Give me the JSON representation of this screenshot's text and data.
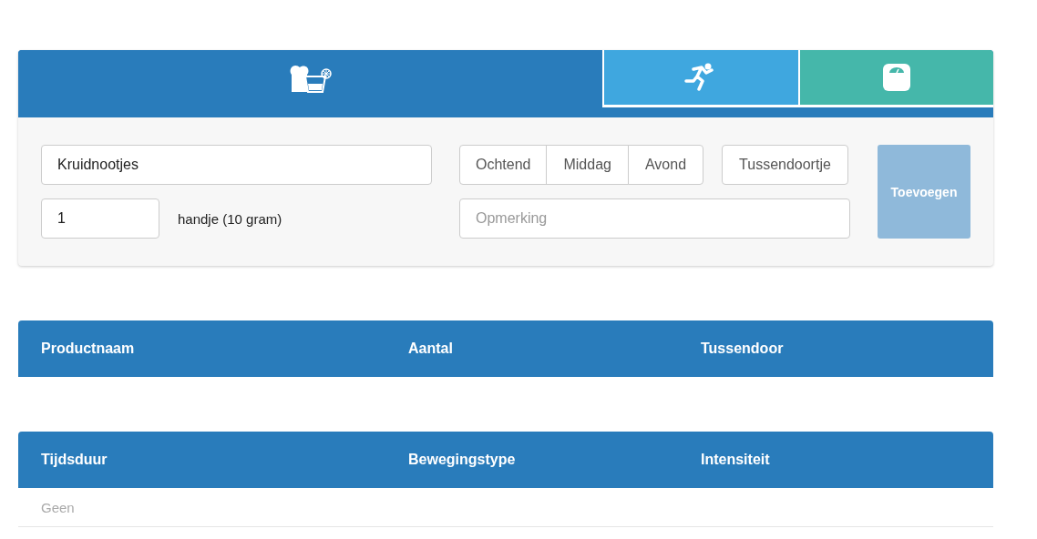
{
  "tabs": [
    {
      "kind": "food",
      "selected": true,
      "color": "#297cbb"
    },
    {
      "kind": "activity",
      "selected": false,
      "color": "#3fa7df"
    },
    {
      "kind": "weight",
      "selected": false,
      "color": "#45b7aa"
    }
  ],
  "form": {
    "product": {
      "value": "Kruidnootjes"
    },
    "amount": {
      "value": "1"
    },
    "unit": "handje (10 gram)",
    "moments": [
      {
        "label": "Ochtend",
        "selected": false
      },
      {
        "label": "Middag",
        "selected": false
      },
      {
        "label": "Avond",
        "selected": false
      }
    ],
    "snack": {
      "label": "Tussendoortje",
      "selected": false
    },
    "remark": {
      "placeholder": "Opmerking"
    },
    "add_button": {
      "label": "Toevoegen",
      "disabled": true
    }
  },
  "tables": [
    {
      "columns": [
        "Productnaam",
        "Aantal",
        "Tussendoor"
      ]
    },
    {
      "columns": [
        "Tijdsduur",
        "Bewegingstype",
        "Intensiteit"
      ],
      "empty_text": "Geen"
    }
  ]
}
